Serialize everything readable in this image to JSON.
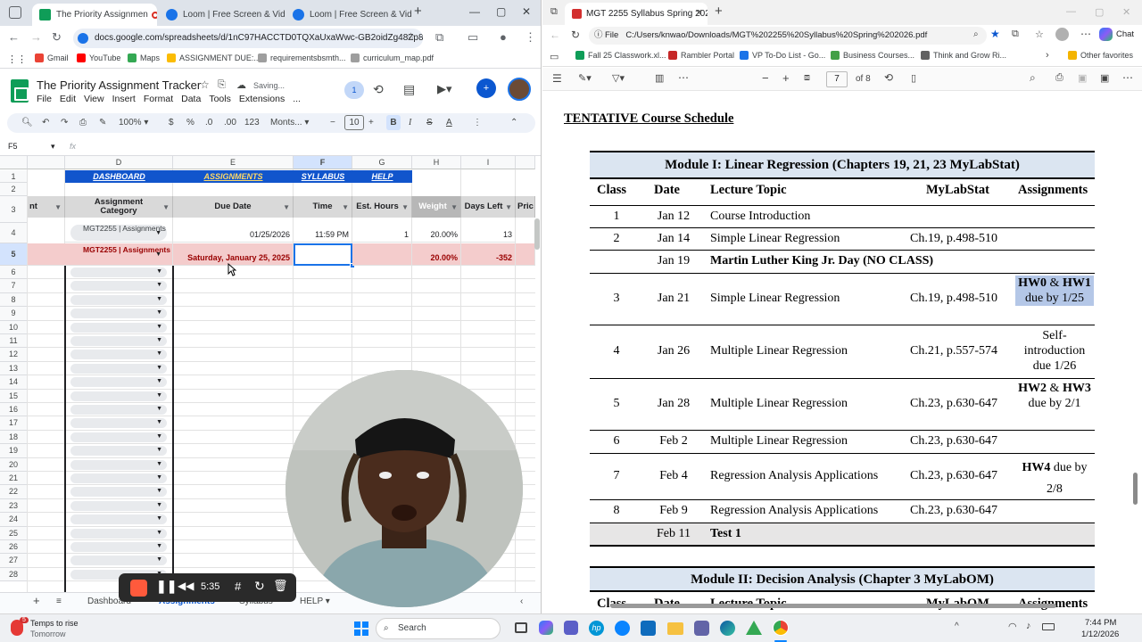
{
  "left_browser": {
    "tabs": [
      {
        "label": "The Priority Assignmen",
        "active": true
      },
      {
        "label": "Loom | Free Screen & Vid",
        "active": false
      },
      {
        "label": "Loom | Free Screen & Vid",
        "active": false
      }
    ],
    "url": "docs.google.com/spreadsheets/d/1nC97HACCTD0TQXaUxaWwc-GB2oidZg48Zp8...",
    "bookmarks": [
      "Gmail",
      "YouTube",
      "Maps",
      "ASSIGNMENT DUE:...",
      "requirementsbsmth...",
      "curriculum_map.pdf"
    ]
  },
  "sheet": {
    "title": "The Priority Assignment Tracker",
    "save_status": "Saving...",
    "menu": [
      "File",
      "Edit",
      "View",
      "Insert",
      "Format",
      "Data",
      "Tools",
      "Extensions",
      "..."
    ],
    "zoom": "100%",
    "font": "Monts...",
    "font_size": "10",
    "name_box": "F5",
    "notif_count": "1",
    "col_letters": [
      "D",
      "E",
      "F",
      "G",
      "H",
      "I"
    ],
    "nav_links": [
      "DASHBOARD",
      "ASSIGNMENTS",
      "SYLLABUS",
      "HELP"
    ],
    "headers": {
      "a": "nt",
      "d": "Assignment Category",
      "e": "Due Date",
      "f": "Time",
      "g": "Est. Hours",
      "h": "Weight",
      "i": "Days Left",
      "j": "Pric"
    },
    "row4": {
      "d": "MGT2255 | Assignments",
      "e": "01/25/2026",
      "f": "11:59 PM",
      "g": "1",
      "h": "20.00%",
      "i": "13"
    },
    "row5": {
      "d": "MGT2255 | Assignments",
      "e": "Saturday, January 25, 2025",
      "f": "",
      "g": "",
      "h": "20.00%",
      "i": "-352"
    },
    "row_numbers": [
      "1",
      "2",
      "3",
      "4",
      "5",
      "6",
      "7",
      "8",
      "9",
      "10",
      "11",
      "12",
      "13",
      "14",
      "15",
      "16",
      "17",
      "18",
      "19",
      "20",
      "21",
      "22",
      "23",
      "24",
      "25",
      "26",
      "27",
      "28"
    ],
    "sheet_tabs": [
      "Dashboard",
      "Assignments",
      "Syllabus",
      "HELP"
    ]
  },
  "recorder": {
    "time": "5:35"
  },
  "right_browser": {
    "tab_label": "MGT 2255 Syllabus Spring 2026.pd",
    "file_label": "File",
    "url": "C:/Users/knwao/Downloads/MGT%202255%20Syllabus%20Spring%202026.pdf",
    "chat": "Chat",
    "favorites": [
      "Fall 25 Classwork.xl...",
      "Rambler Portal",
      "VP To-Do List - Go...",
      "Business Courses...",
      "Think and Grow Ri..."
    ],
    "other_favorites": "Other favorites",
    "page_current": "7",
    "page_total": "of 8"
  },
  "pdf": {
    "heading": "TENTATIVE Course Schedule",
    "module1_title": "Module I: Linear Regression (Chapters 19, 21, 23 MyLabStat)",
    "module1_cols": [
      "Class",
      "Date",
      "Lecture Topic",
      "MyLabStat",
      "Assignments"
    ],
    "rows": [
      {
        "class": "1",
        "date": "Jan 12",
        "topic": "Course Introduction",
        "ref": "",
        "assign": ""
      },
      {
        "class": "2",
        "date": "Jan 14",
        "topic": "Simple Linear Regression",
        "ref": "Ch.19, p.498-510",
        "assign": ""
      },
      {
        "class": "",
        "date": "Jan 19",
        "topic": "Martin Luther King Jr. Day (NO CLASS)",
        "ref": "",
        "assign": ""
      },
      {
        "class": "3",
        "date": "Jan 21",
        "topic": "Simple Linear Regression",
        "ref": "Ch.19, p.498-510",
        "assign": ""
      },
      {
        "class": "4",
        "date": "Jan 26",
        "topic": "Multiple Linear Regression",
        "ref": "Ch.21, p.557-574",
        "assign": ""
      },
      {
        "class": "5",
        "date": "Jan 28",
        "topic": "Multiple Linear Regression",
        "ref": "Ch.23, p.630-647",
        "assign": ""
      },
      {
        "class": "6",
        "date": "Feb 2",
        "topic": "Multiple Linear Regression",
        "ref": "Ch.23, p.630-647",
        "assign": ""
      },
      {
        "class": "7",
        "date": "Feb 4",
        "topic": "Regression Analysis Applications",
        "ref": "Ch.23, p.630-647",
        "assign": ""
      },
      {
        "class": "8",
        "date": "Feb 9",
        "topic": "Regression Analysis Applications",
        "ref": "Ch.23, p.630-647",
        "assign": ""
      },
      {
        "class": "",
        "date": "Feb 11",
        "topic": "Test 1",
        "ref": "",
        "assign": ""
      }
    ],
    "assign_row3": {
      "b1": "HW0",
      "t1": " & ",
      "b2": "HW1",
      "t2": " due by 1/25"
    },
    "assign_row4": "Self-introduction due 1/26",
    "assign_row5": {
      "b1": "HW2",
      "t1": " & ",
      "b2": "HW3",
      "t2": " due by 2/1"
    },
    "assign_row7": {
      "b1": "HW4",
      "t2": " due by 2/8"
    },
    "module2_title": "Module II: Decision Analysis (Chapter 3 MyLabOM)",
    "module2_cols": [
      "Class",
      "Date",
      "Lecture Topic",
      "MyLabOM",
      "Assignments"
    ]
  },
  "taskbar": {
    "weather_title": "Temps to rise",
    "weather_sub": "Tomorrow",
    "weather_badge": "5",
    "search": "Search",
    "time": "7:44 PM",
    "date": "1/12/2026"
  }
}
